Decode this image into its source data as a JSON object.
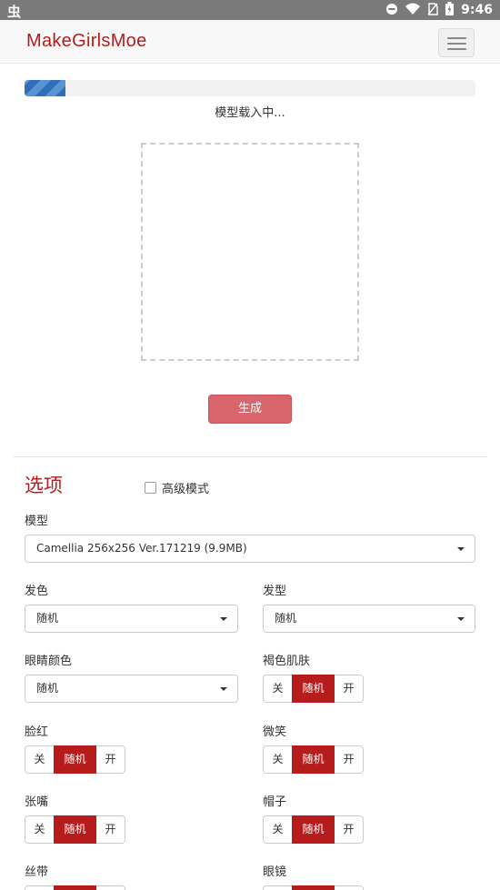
{
  "status_bar": {
    "app_glyph": "虫",
    "time": "9:46",
    "icons": [
      "minus-circle-icon",
      "wifi-icon",
      "no-sim-icon",
      "battery-icon"
    ]
  },
  "navbar": {
    "brand": "MakeGirlsMoe",
    "menu_icon": "hamburger-icon"
  },
  "progress": {
    "value": 0.09,
    "text": "模型载入中..."
  },
  "generate_label": "生成",
  "options": {
    "title": "选项",
    "advanced_label": "高级模式",
    "advanced_checked": false,
    "model_label": "模型",
    "model_value": "Camellia 256x256 Ver.171219 (9.9MB)",
    "hair_color_label": "发色",
    "hair_color_value": "随机",
    "hair_style_label": "发型",
    "hair_style_value": "随机",
    "eye_color_label": "眼睛颜色",
    "eye_color_value": "随机",
    "toggles": {
      "off": "关",
      "random": "随机",
      "on": "开"
    },
    "dark_skin_label": "褐色肌肤",
    "blush_label": "脸红",
    "smile_label": "微笑",
    "open_mouth_label": "张嘴",
    "hat_label": "帽子",
    "ribbon_label": "丝带",
    "glasses_label": "眼镜"
  },
  "colors": {
    "accent": "#b71c1c",
    "generate_button": "#d9666c",
    "progress": "#2f6fb7"
  }
}
